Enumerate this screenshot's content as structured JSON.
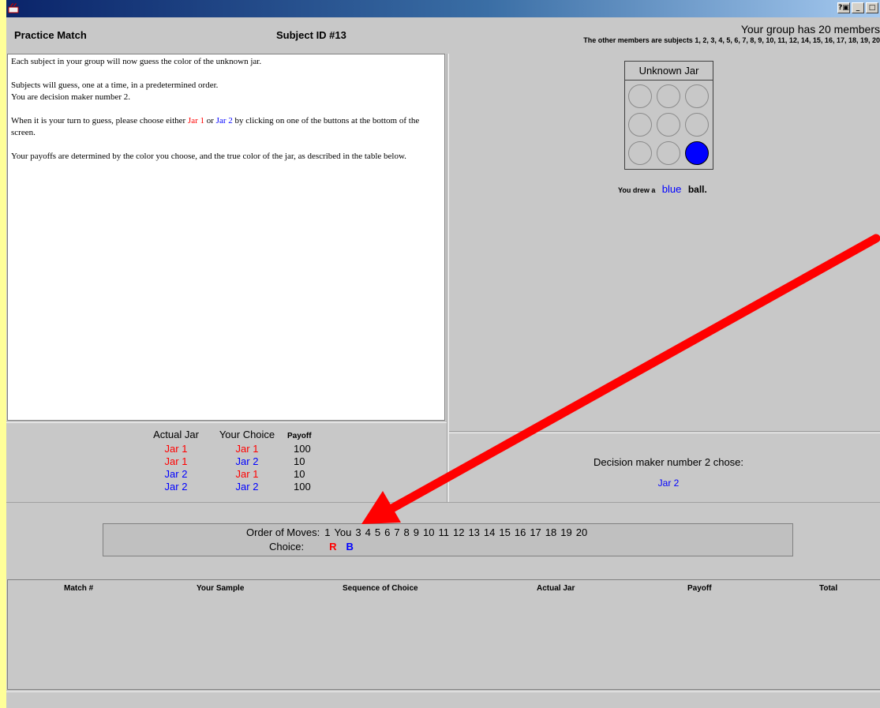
{
  "header": {
    "title": "Practice Match",
    "subject_id": "Subject ID #13",
    "group_size": "Your group has 20 members",
    "other_members": "The other members are subjects 1, 2, 3, 4, 5, 6, 7, 8, 9, 10, 11, 12, 14, 15, 16, 17, 18, 19, 20"
  },
  "window_buttons": [
    "?▣",
    "_",
    "□"
  ],
  "instructions": {
    "p1": "Each subject in your group will now guess the color of the unknown jar.",
    "p2a": "Subjects will guess, one at a time, in a predetermined order.",
    "p2b": "You are decision maker number 2.",
    "p3_pre": "When it is your turn to guess, please choose either ",
    "p3_jar1": "Jar 1",
    "p3_or": " or ",
    "p3_jar2": "Jar 2",
    "p3_post": " by clicking on one of the buttons at the bottom of the screen.",
    "p4": "Your payoffs are determined by the color you choose, and the true color of the jar, as described in the table below."
  },
  "payoff_table": {
    "headers": [
      "Actual Jar",
      "Your Choice",
      "Payoff"
    ],
    "rows": [
      {
        "actual": "Jar 1",
        "choice": "Jar 1",
        "payoff": "100"
      },
      {
        "actual": "Jar 1",
        "choice": "Jar 2",
        "payoff": "10"
      },
      {
        "actual": "Jar 2",
        "choice": "Jar 1",
        "payoff": "10"
      },
      {
        "actual": "Jar 2",
        "choice": "Jar 2",
        "payoff": "100"
      }
    ],
    "colors": {
      "Jar 1": "#ff0000",
      "Jar 2": "#0000ff"
    }
  },
  "jar": {
    "title": "Unknown Jar",
    "balls": [
      "empty",
      "empty",
      "empty",
      "empty",
      "empty",
      "empty",
      "empty",
      "empty",
      "blue"
    ],
    "drew_prefix": "You drew a",
    "drew_color": "blue",
    "drew_suffix": "ball."
  },
  "decision": {
    "label": "Decision maker number 2 chose:",
    "value": "Jar 2"
  },
  "order": {
    "label": "Order of Moves:",
    "moves": [
      "1",
      "You",
      "3",
      "4",
      "5",
      "6",
      "7",
      "8",
      "9",
      "10",
      "11",
      "12",
      "13",
      "14",
      "15",
      "16",
      "17",
      "18",
      "19",
      "20"
    ],
    "choice_label": "Choice:",
    "choice_r": "R",
    "choice_b": "B"
  },
  "results": {
    "columns": [
      "Match #",
      "Your Sample",
      "Sequence of Choice",
      "Actual Jar",
      "Payoff",
      "Total"
    ]
  },
  "colors": {
    "accent_red": "#ff0000",
    "accent_blue": "#0000ff",
    "panel_gray": "#c8c8c8",
    "desktop": "#ffff99"
  }
}
